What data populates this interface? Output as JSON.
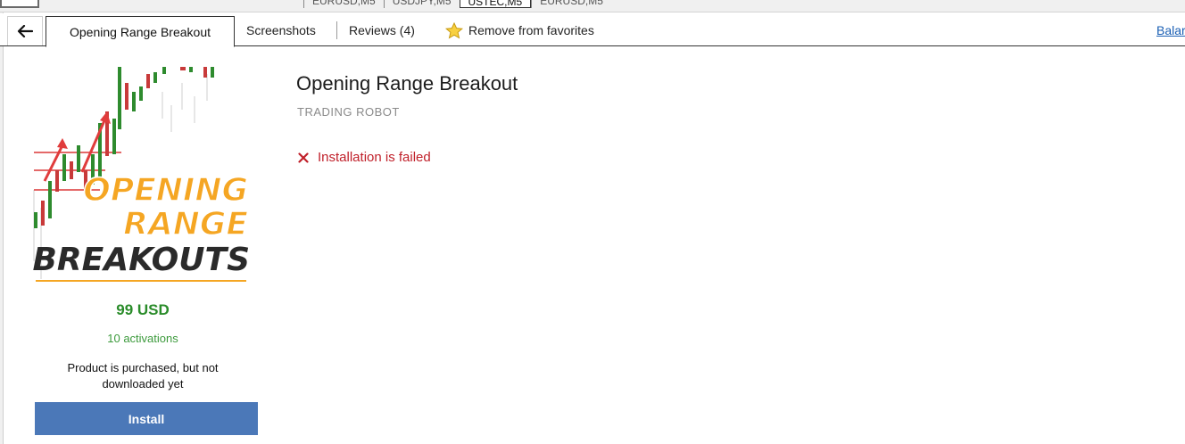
{
  "symbol_tabs": [
    "EURUSD,M5",
    "USDJPY,M5",
    "USTEC,M5",
    "EURUSD,M5"
  ],
  "symbol_tab_active_index": 2,
  "tabs": {
    "active": "Opening Range Breakout",
    "screenshots": "Screenshots",
    "reviews": "Reviews (4)",
    "favorites": "Remove from favorites",
    "balance": "Balar"
  },
  "product": {
    "image_caption_lines": [
      "OPENING",
      "RANGE",
      "BREAKOUTS"
    ],
    "price": "99 USD",
    "activations": "10 activations",
    "status": "Product is purchased, but not downloaded yet",
    "install_label": "Install"
  },
  "main": {
    "title": "Opening Range Breakout",
    "subtitle": "TRADING ROBOT",
    "error": "Installation is failed"
  },
  "colors": {
    "price": "#2a8c2a",
    "error": "#c0202a",
    "install_button": "#4b78b8",
    "link": "#1a5fb4",
    "logo_text": "#f5a623"
  },
  "icons": {
    "back": "arrow-left-icon",
    "favorite": "star-icon",
    "error": "x-icon"
  }
}
